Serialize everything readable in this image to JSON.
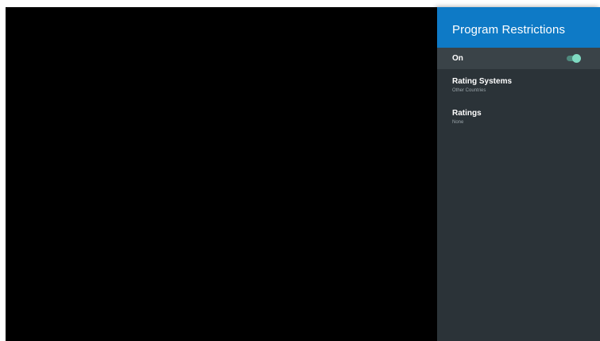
{
  "panel": {
    "title": "Program Restrictions",
    "toggle_row": {
      "label": "On",
      "state": "on"
    },
    "items": [
      {
        "label": "Rating Systems",
        "sub": "Other Countries"
      },
      {
        "label": "Ratings",
        "sub": "None"
      }
    ]
  },
  "colors": {
    "header": "#0e7ac6",
    "panel_bg": "#2b3338",
    "selected_row": "#3a4348",
    "toggle_on": "#7fdac2"
  }
}
